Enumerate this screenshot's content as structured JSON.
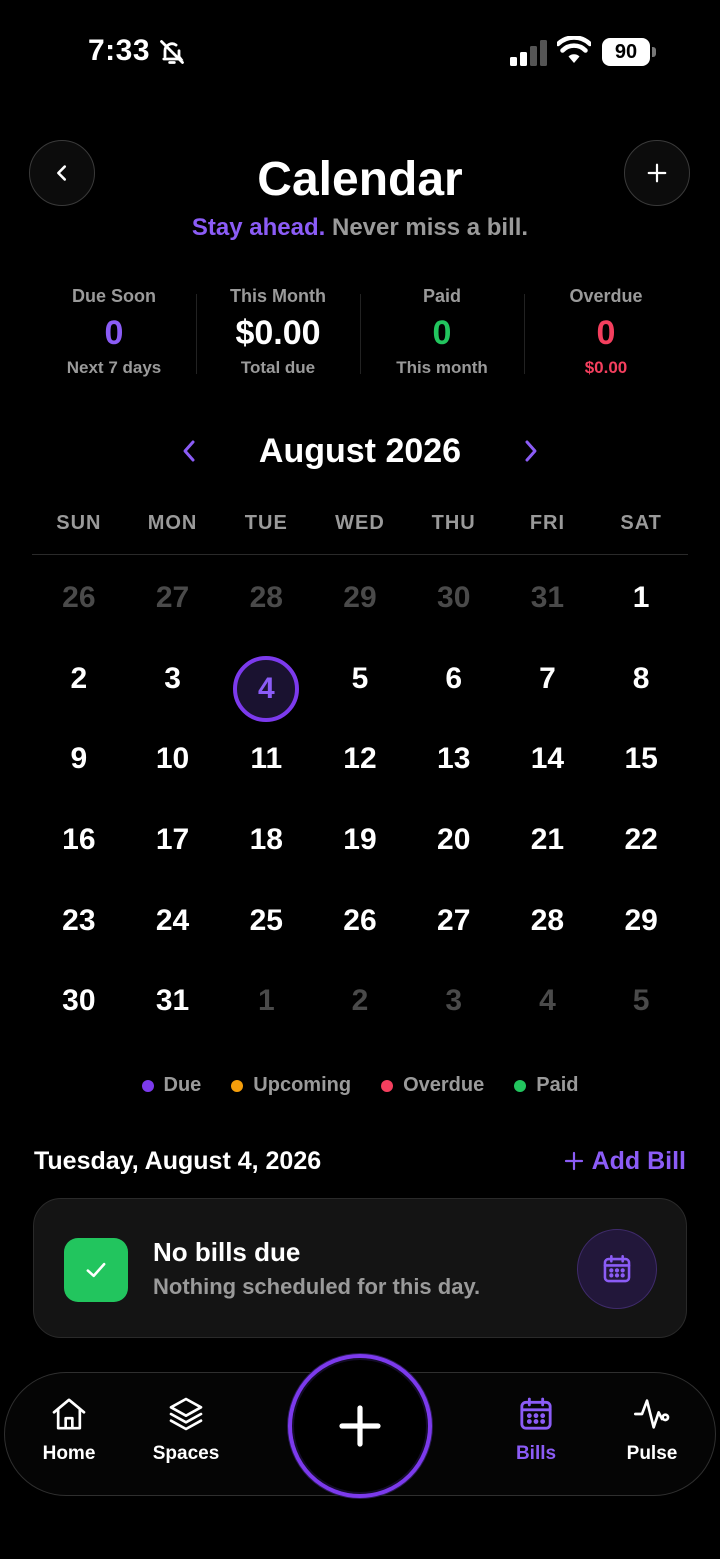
{
  "status_bar": {
    "time": "7:33",
    "battery": "90"
  },
  "header": {
    "title": "Calendar",
    "subtitle_accent": "Stay ahead.",
    "subtitle_rest": " Never miss a bill."
  },
  "stats": [
    {
      "label": "Due Soon",
      "value": "0",
      "sub": "Next 7 days",
      "value_color": "#8b5cf6",
      "sub_color": "#9a9a9a"
    },
    {
      "label": "This Month",
      "value": "$0.00",
      "sub": "Total due",
      "value_color": "#ffffff",
      "sub_color": "#9a9a9a"
    },
    {
      "label": "Paid",
      "value": "0",
      "sub": "This month",
      "value_color": "#22c55e",
      "sub_color": "#9a9a9a"
    },
    {
      "label": "Overdue",
      "value": "0",
      "sub": "$0.00",
      "value_color": "#f43f5e",
      "sub_color": "#f43f5e"
    }
  ],
  "month_label": "August 2026",
  "weekdays": [
    "SUN",
    "MON",
    "TUE",
    "WED",
    "THU",
    "FRI",
    "SAT"
  ],
  "days": [
    {
      "n": "26",
      "muted": true
    },
    {
      "n": "27",
      "muted": true
    },
    {
      "n": "28",
      "muted": true
    },
    {
      "n": "29",
      "muted": true
    },
    {
      "n": "30",
      "muted": true
    },
    {
      "n": "31",
      "muted": true
    },
    {
      "n": "1"
    },
    {
      "n": "2"
    },
    {
      "n": "3"
    },
    {
      "n": "4",
      "today": true
    },
    {
      "n": "5"
    },
    {
      "n": "6"
    },
    {
      "n": "7"
    },
    {
      "n": "8"
    },
    {
      "n": "9"
    },
    {
      "n": "10"
    },
    {
      "n": "11"
    },
    {
      "n": "12"
    },
    {
      "n": "13"
    },
    {
      "n": "14"
    },
    {
      "n": "15"
    },
    {
      "n": "16"
    },
    {
      "n": "17"
    },
    {
      "n": "18"
    },
    {
      "n": "19"
    },
    {
      "n": "20"
    },
    {
      "n": "21"
    },
    {
      "n": "22"
    },
    {
      "n": "23"
    },
    {
      "n": "24"
    },
    {
      "n": "25"
    },
    {
      "n": "26"
    },
    {
      "n": "27"
    },
    {
      "n": "28"
    },
    {
      "n": "29"
    },
    {
      "n": "30"
    },
    {
      "n": "31"
    },
    {
      "n": "1",
      "muted": true
    },
    {
      "n": "2",
      "muted": true
    },
    {
      "n": "3",
      "muted": true
    },
    {
      "n": "4",
      "muted": true
    },
    {
      "n": "5",
      "muted": true
    }
  ],
  "legend": [
    {
      "label": "Due",
      "color": "#7c3aed"
    },
    {
      "label": "Upcoming",
      "color": "#f59e0b"
    },
    {
      "label": "Overdue",
      "color": "#f43f5e"
    },
    {
      "label": "Paid",
      "color": "#22c55e"
    }
  ],
  "selected": {
    "date": "Tuesday, August 4, 2026",
    "add_bill_label": "Add Bill"
  },
  "empty_card": {
    "title": "No bills due",
    "message": "Nothing scheduled for this day."
  },
  "tabs": {
    "home": "Home",
    "spaces": "Spaces",
    "bills": "Bills",
    "pulse": "Pulse"
  },
  "colors": {
    "accent": "#8b5cf6",
    "background": "#000000",
    "success": "#22c55e",
    "danger": "#f43f5e"
  }
}
